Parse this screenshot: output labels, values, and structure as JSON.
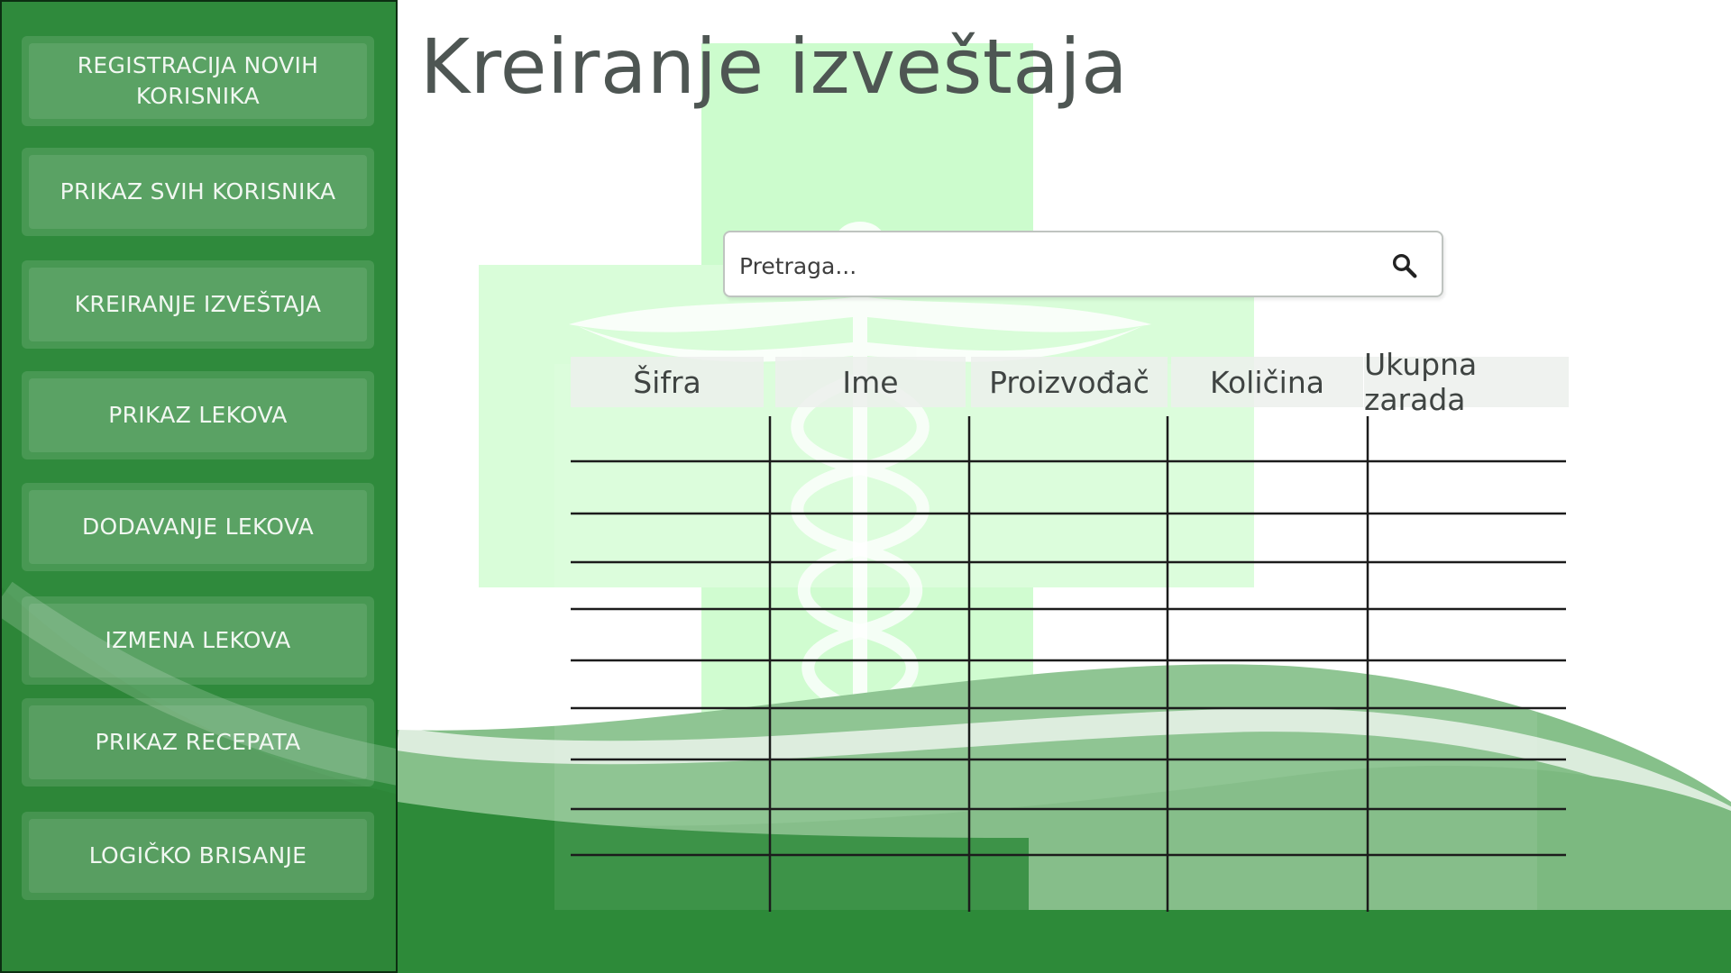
{
  "sidebar": {
    "items": [
      {
        "label": "REGISTRACIJA NOVIH KORISNIKA"
      },
      {
        "label": "PRIKAZ SVIH KORISNIKA"
      },
      {
        "label": "KREIRANJE IZVEŠTAJA"
      },
      {
        "label": "PRIKAZ LEKOVA"
      },
      {
        "label": "DODAVANJE LEKOVA"
      },
      {
        "label": "IZMENA LEKOVA"
      },
      {
        "label": "PRIKAZ RECEPATA"
      },
      {
        "label": "LOGIČKO BRISANJE"
      }
    ]
  },
  "main": {
    "title": "Kreiranje izveštaja",
    "search": {
      "placeholder": "Pretraga...",
      "value": "",
      "icon": "search-icon"
    },
    "table": {
      "columns": [
        "Šifra",
        "Ime",
        "Proizvođač",
        "Količina",
        "Ukupna zarada"
      ],
      "rows": [
        [
          "",
          "",
          "",
          "",
          ""
        ],
        [
          "",
          "",
          "",
          "",
          ""
        ],
        [
          "",
          "",
          "",
          "",
          ""
        ],
        [
          "",
          "",
          "",
          "",
          ""
        ],
        [
          "",
          "",
          "",
          "",
          ""
        ],
        [
          "",
          "",
          "",
          "",
          ""
        ],
        [
          "",
          "",
          "",
          "",
          ""
        ],
        [
          "",
          "",
          "",
          "",
          ""
        ],
        [
          "",
          "",
          "",
          "",
          ""
        ],
        [
          "",
          "",
          "",
          "",
          ""
        ]
      ]
    }
  },
  "colors": {
    "sidebar_green": "#2f8a3c",
    "dark_green": "#2d8a39",
    "light_green": "#ccfccd",
    "title_gray": "#4e5653"
  }
}
